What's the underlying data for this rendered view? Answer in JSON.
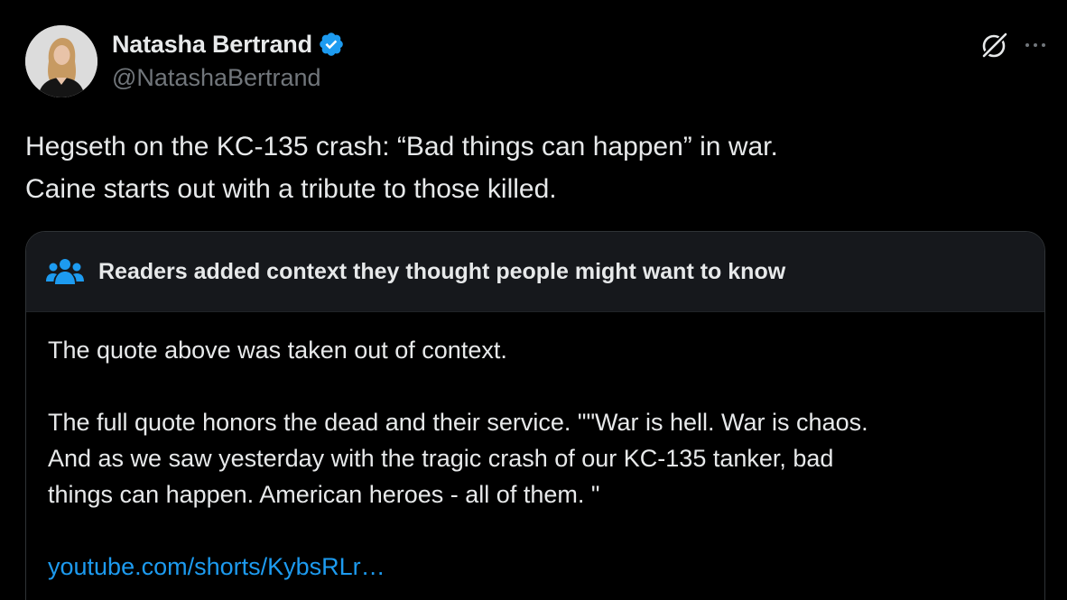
{
  "author": {
    "display_name": "Natasha Bertrand",
    "handle": "@NatashaBertrand",
    "verified_color": "#1d9bf0",
    "avatar_icon": "profile-photo"
  },
  "actions": {
    "grok_icon": "grok-icon",
    "more_icon": "more-options-icon",
    "more_label": "···"
  },
  "tweet": {
    "lines": [
      "Hegseth on the KC-135 crash: “Bad things can happen” in war.",
      "Caine starts out with a tribute to those killed."
    ]
  },
  "community_note": {
    "icon": "people-icon",
    "title": "Readers added context they thought people might want to know",
    "paragraph1": "The quote above was taken out of context.",
    "paragraph2_lines": [
      "The full quote honors the dead and their service.   \"\"War is hell. War is chaos.",
      "And as we saw yesterday with the tragic crash of our KC-135 tanker, bad",
      "things can happen. American heroes - all of them. \""
    ],
    "link_text": "youtube.com/shorts/KybsRLr…",
    "link_color": "#1d9bf0"
  },
  "colors": {
    "background": "#000000",
    "text_primary": "#e7e9ea",
    "text_secondary": "#71767b",
    "note_header_bg": "#16181c",
    "border": "#2f3336"
  }
}
